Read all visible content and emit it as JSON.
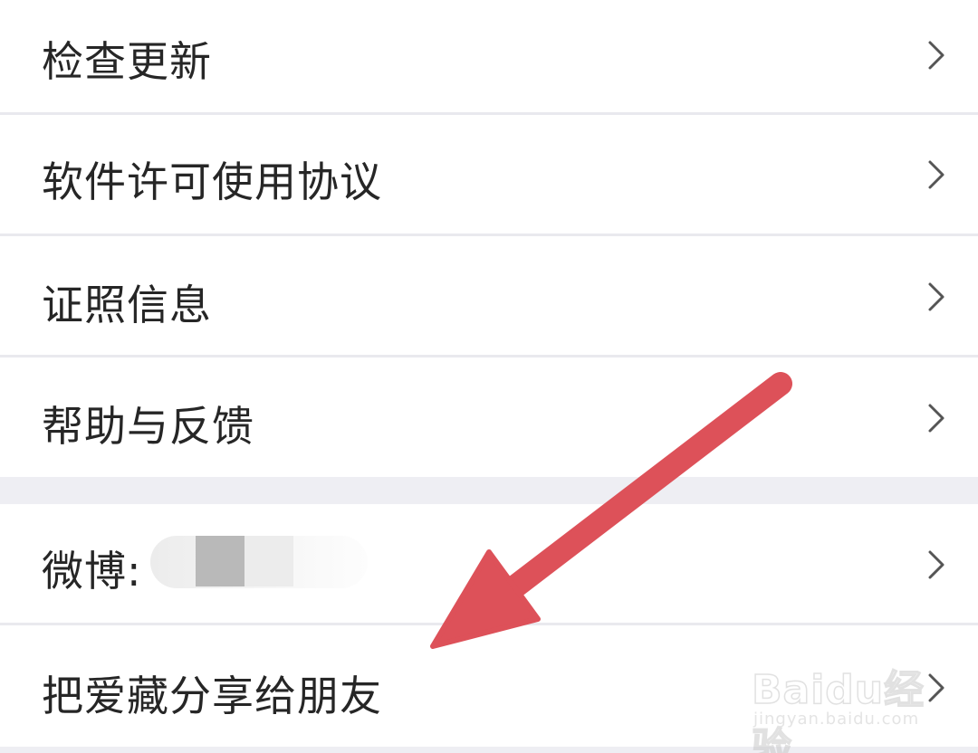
{
  "settings_list": {
    "group1": [
      {
        "label": "检查更新"
      },
      {
        "label": "软件许可使用协议"
      },
      {
        "label": "证照信息"
      },
      {
        "label": "帮助与反馈"
      }
    ],
    "group2": [
      {
        "label": "微博:"
      },
      {
        "label": "把爱藏分享给朋友"
      }
    ]
  },
  "watermark": {
    "logo": "Baidu经验",
    "url": "jingyan.baidu.com"
  },
  "colors": {
    "text": "#262626",
    "chevron": "#555555",
    "divider": "#e9e9ee",
    "section_gap": "#eeeef3",
    "annotation_arrow": "#dd5159"
  },
  "icons": {
    "chevron": "chevron-right-icon",
    "annotation": "red-arrow-annotation"
  }
}
